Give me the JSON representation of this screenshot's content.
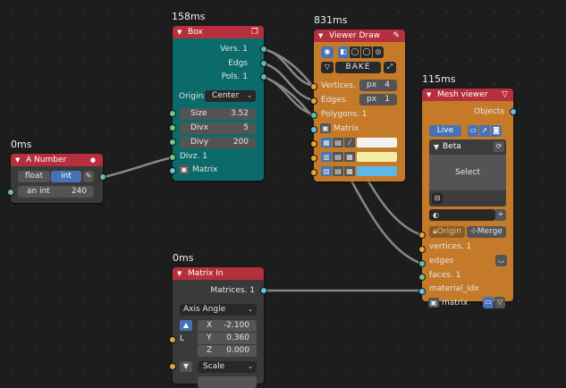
{
  "timings": {
    "box": "158ms",
    "viewer_draw": "831ms",
    "mesh_viewer": "115ms",
    "a_number": "0ms",
    "matrix_in": "0ms"
  },
  "a_number": {
    "title": "A Number",
    "mode_float": "float",
    "mode_int": "int",
    "field_label": "an int",
    "field_value": "240"
  },
  "box": {
    "title": "Box",
    "outputs": [
      "Vers. 1",
      "Edgs",
      "Pols. 1"
    ],
    "origin_label": "Origin:",
    "origin_value": "Center",
    "fields": [
      {
        "label": "Size",
        "value": "3.52"
      },
      {
        "label": "Divx",
        "value": "5"
      },
      {
        "label": "Divy",
        "value": "200"
      }
    ],
    "inputs": [
      "Divz. 1",
      "Matrix"
    ]
  },
  "viewer_draw": {
    "title": "Viewer Draw",
    "bake": "BAKE",
    "inputs": [
      {
        "label": "Vertices. 1",
        "unit": "px",
        "value": "4"
      },
      {
        "label": "Edges.",
        "unit": "px",
        "value": "1"
      }
    ],
    "polygons": "Polygons. 1",
    "matrix": "Matrix",
    "colors": {
      "vertex": "#f2f2f2",
      "edge": "#f2eea6",
      "face": "#5bb8e8"
    }
  },
  "mesh_viewer": {
    "title": "Mesh viewer",
    "objects": "Objects",
    "live": "Live",
    "name": "Beta",
    "select": "Select",
    "origin": "Origin",
    "merge": "Merge",
    "inputs": [
      "vertices. 1",
      "edges",
      "faces. 1",
      "material_idx",
      "matrix"
    ]
  },
  "matrix_in": {
    "title": "Matrix In",
    "output": "Matrices. 1",
    "mode": "Axis Angle",
    "L": "L",
    "values": [
      {
        "label": "X",
        "value": "-2.100"
      },
      {
        "label": "Y",
        "value": "0.360"
      },
      {
        "label": "Z",
        "value": "0.000"
      }
    ],
    "scale": "Scale"
  },
  "colors": {
    "header": "#b5303c",
    "box_body": "#0b6a6a",
    "viewer_body": "#c57a2a",
    "number_body": "#3a3a3a",
    "matrix_body": "#3a3a3a",
    "accent": "#4772b3"
  }
}
